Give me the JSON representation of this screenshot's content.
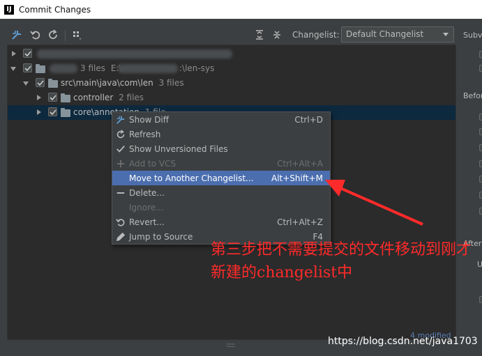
{
  "window": {
    "title": "Commit Changes",
    "logo_text": "IJ"
  },
  "toolbar": {
    "icons": [
      "show-diff-icon",
      "rollback-icon",
      "refresh-icon",
      "group-by-icon",
      "expand-all-icon",
      "collapse-all-icon"
    ],
    "changelist_label": "Changelist:",
    "changelist_value": "Default Changelist"
  },
  "tree": {
    "rows": [
      {
        "text": ""
      },
      {
        "text_suffix": "3 files",
        "path_prefix": "E:\\",
        "path_suffix": ":\\len-sys"
      },
      {
        "text": "src\\main\\java\\com\\len",
        "count": "3 files"
      },
      {
        "text": "controller",
        "count": "2 files"
      },
      {
        "text": "core\\annotation",
        "count": "1 file"
      }
    ]
  },
  "context_menu": {
    "items": [
      {
        "label": "Show Diff",
        "shortcut": "Ctrl+D",
        "icon": "show-diff-icon",
        "state": "normal"
      },
      {
        "label": "Refresh",
        "shortcut": "",
        "icon": "refresh-icon",
        "state": "normal"
      },
      {
        "label": "Show Unversioned Files",
        "shortcut": "",
        "icon": "checkmark-icon",
        "state": "normal"
      },
      {
        "label": "Add to VCS",
        "shortcut": "Ctrl+Alt+A",
        "icon": "plus-icon",
        "state": "disabled"
      },
      {
        "label": "Move to Another Changelist...",
        "shortcut": "Alt+Shift+M",
        "icon": "",
        "state": "highlighted"
      },
      {
        "label": "Delete...",
        "shortcut": "",
        "icon": "minus-icon",
        "state": "normal"
      },
      {
        "label": "Ignore...",
        "shortcut": "",
        "icon": "",
        "state": "disabled"
      },
      {
        "label": "Revert...",
        "shortcut": "Ctrl+Alt+Z",
        "icon": "rollback-icon",
        "state": "normal"
      },
      {
        "label": "Jump to Source",
        "shortcut": "F4",
        "icon": "pencil-icon",
        "state": "normal"
      }
    ]
  },
  "right_panel": {
    "subversion_label": "Subv",
    "before_label": "Befor",
    "after_label": "After",
    "u_label": "U"
  },
  "status": {
    "modified": "4 modified"
  },
  "annotation": {
    "text": "第三步把不需要提交的文件移动到刚才新建的changelist中"
  },
  "watermark": {
    "text": "https://blog.csdn.net/java1703"
  },
  "colors": {
    "accent_red": "#ff2a2a",
    "highlight": "#4b6eaf",
    "background": "#3c3f41",
    "tree_bg": "#2b2b2b"
  }
}
